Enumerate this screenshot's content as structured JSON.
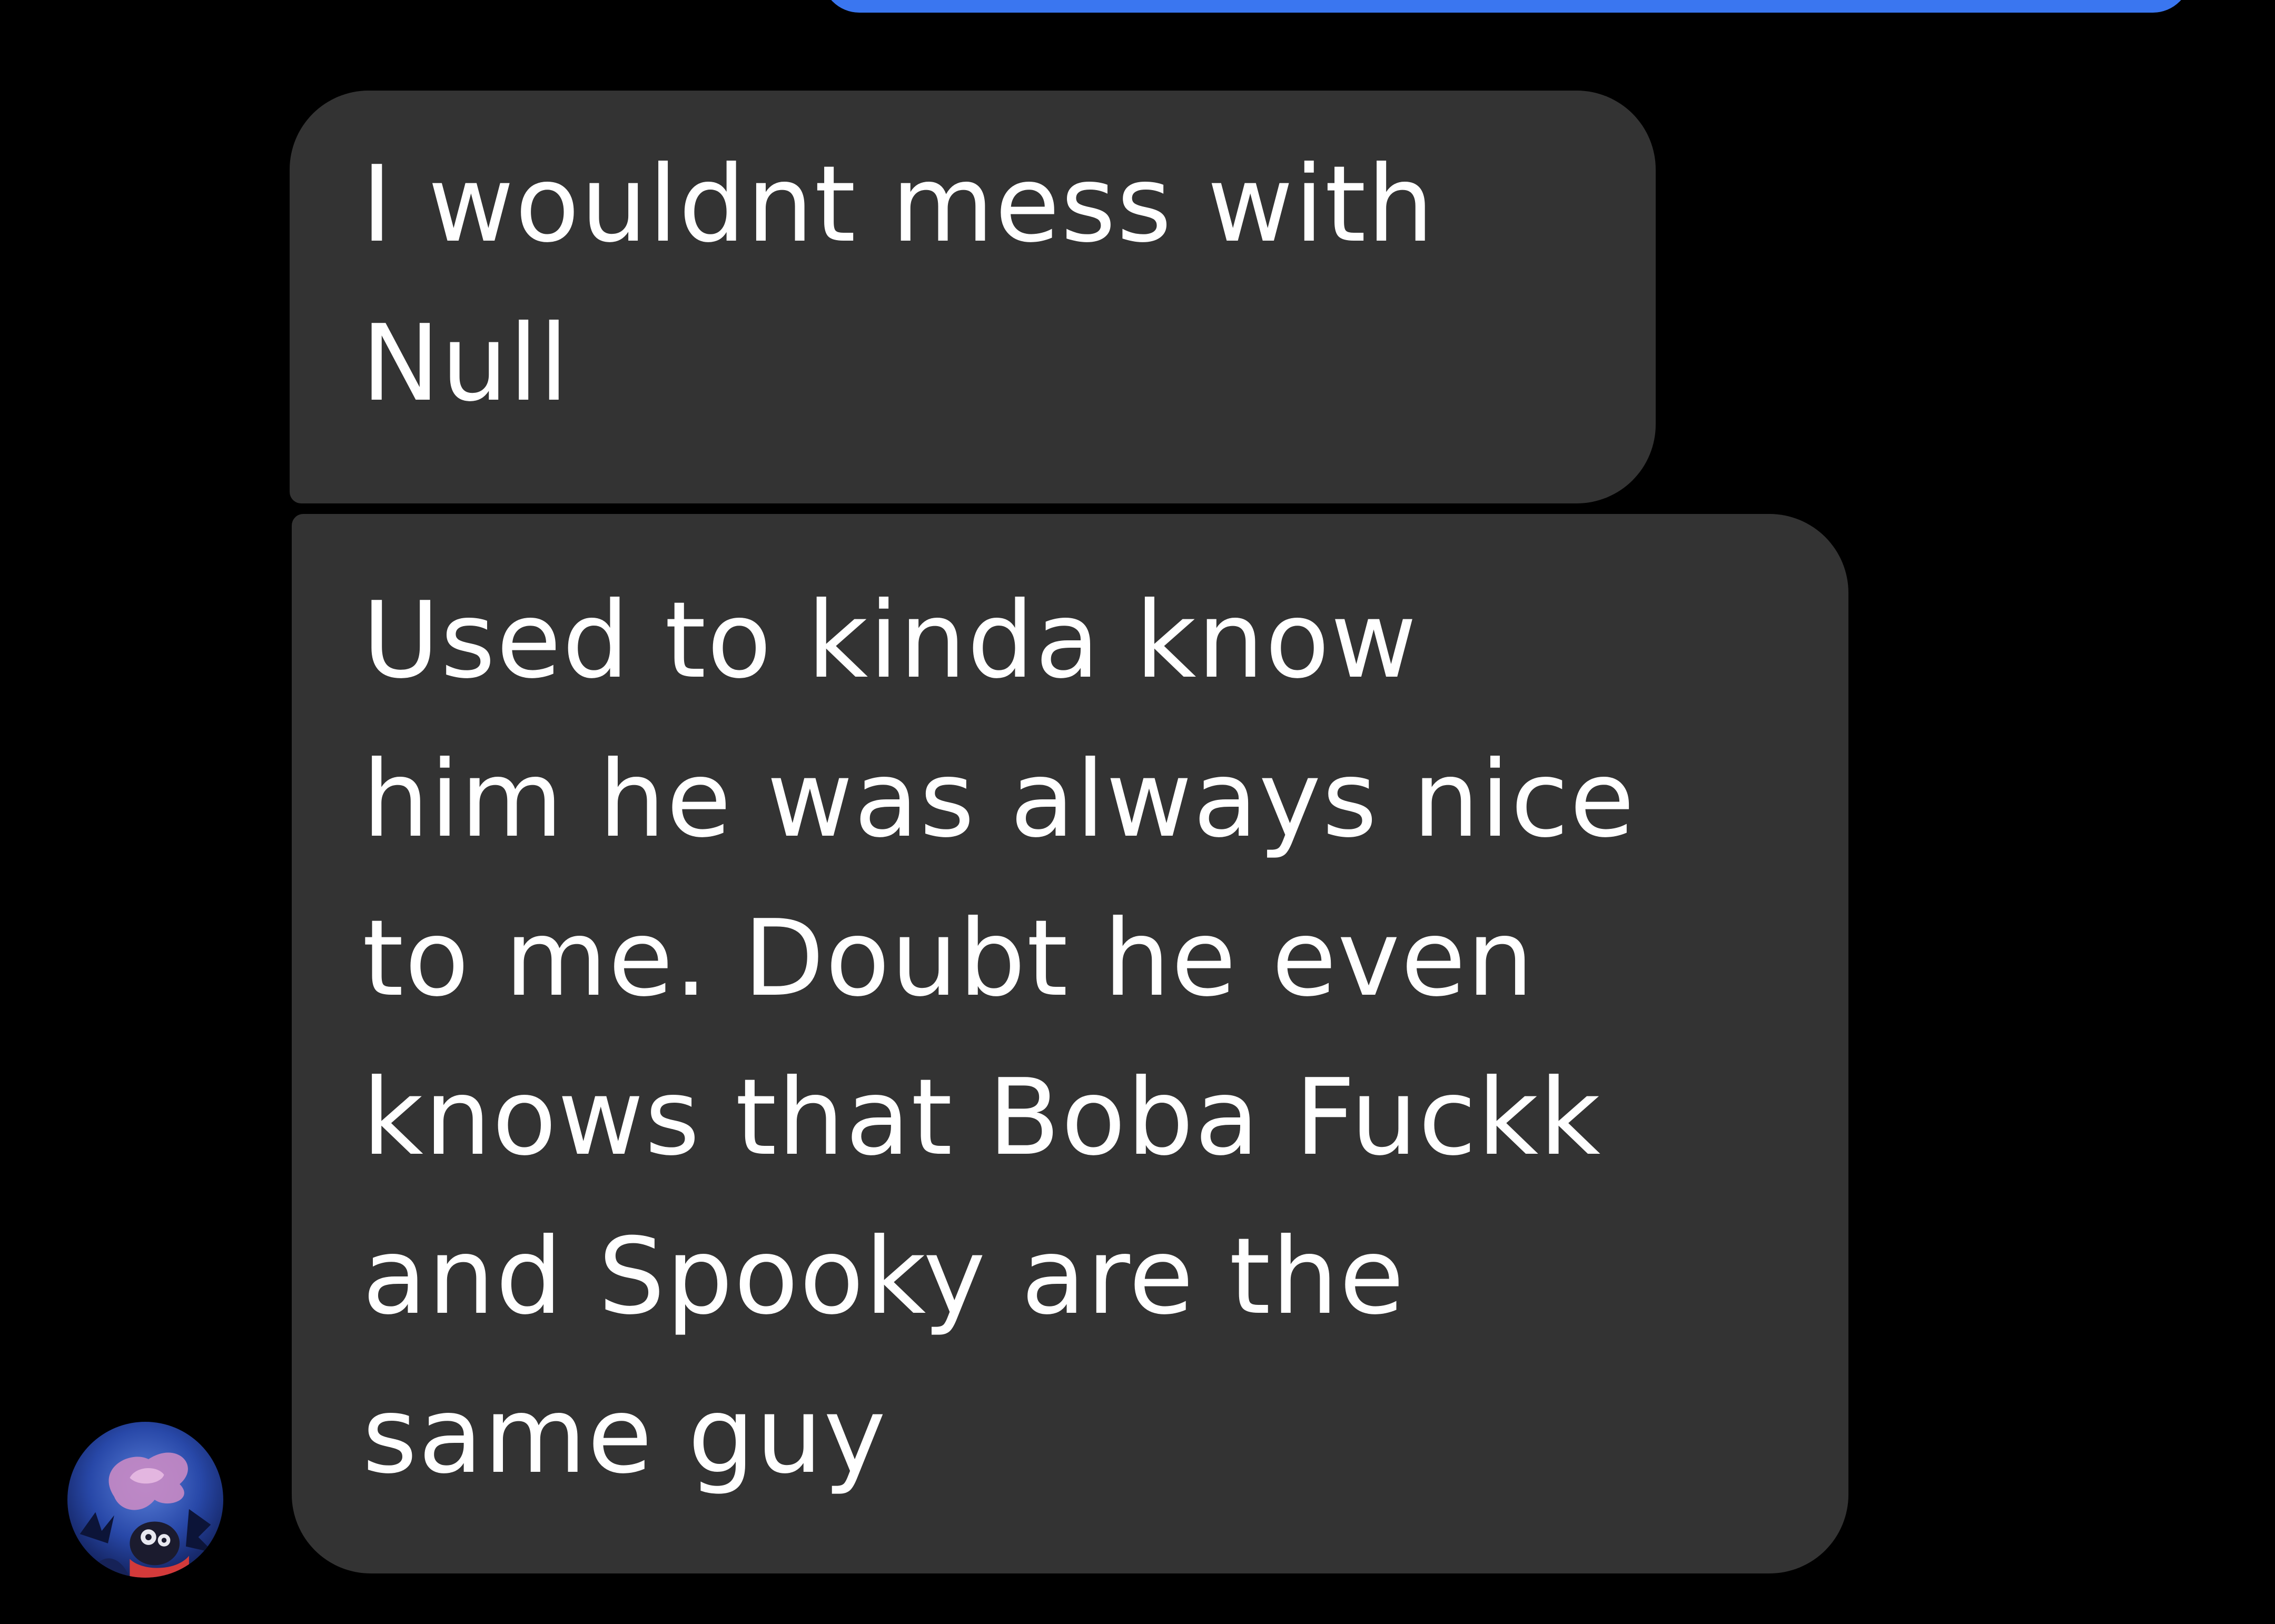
{
  "conversation": {
    "messages": [
      {
        "direction": "incoming",
        "text": "I wouldnt mess with\nNull"
      },
      {
        "direction": "incoming",
        "text": "Used to kinda know\nhim he was always nice\nto me. Doubt he even\nknows that Boba Fuckk\nand Spooky are the\nsame guy"
      }
    ]
  },
  "colors": {
    "background": "#000000",
    "incoming_bubble": "#333333",
    "outgoing_bubble": "#3a76f0",
    "text": "#ffffff"
  },
  "icons": {
    "avatar": "contact-avatar"
  }
}
